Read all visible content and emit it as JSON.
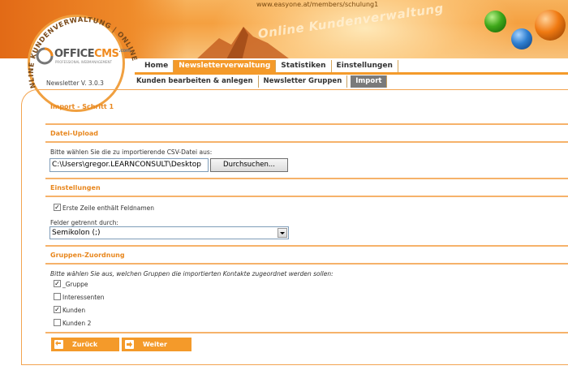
{
  "header": {
    "url": "www.easyone.at/members/schulung1",
    "tagline": "Online Kundenverwaltung",
    "ring_text": "NLINE KUNDENVERWALTUNG | ONLINE KUNDENVERWAL",
    "logo_main": "OFFICE",
    "logo_cms": "CMS",
    "logo_com": ".com",
    "logo_sub": "PROFESSIONAL WEBMANAGEMENT"
  },
  "nav": {
    "items": [
      {
        "label": "Home"
      },
      {
        "label": "Newsletterverwaltung"
      },
      {
        "label": "Statistiken"
      },
      {
        "label": "Einstellungen"
      }
    ],
    "active": "Newsletterverwaltung"
  },
  "version": "Newsletter V. 3.0.3",
  "subnav": {
    "items": [
      {
        "label": "Kunden bearbeiten & anlegen"
      },
      {
        "label": "Newsletter Gruppen"
      },
      {
        "label": "Import"
      }
    ],
    "active": "Import"
  },
  "page": {
    "title": "Import - Schritt 1",
    "upload": {
      "section_title": "Datei-Upload",
      "prompt": "Bitte wählen Sie die zu importierende CSV-Datei aus:",
      "file_value": "C:\\Users\\gregor.LEARNCONSULT\\Desktop",
      "browse_label": "Durchsuchen..."
    },
    "settings": {
      "section_title": "Einstellungen",
      "header_checkbox_label": "Erste Zeile enthält Feldnamen",
      "header_checkbox_checked": true,
      "separator_label": "Felder getrennt durch:",
      "separator_value": "Semikolon (;)"
    },
    "groups": {
      "section_title": "Gruppen-Zuordnung",
      "prompt": "Bitte wählen Sie aus, welchen Gruppen die importierten Kontakte zugeordnet werden sollen:",
      "items": [
        {
          "label": "_Gruppe",
          "checked": true
        },
        {
          "label": "Interessenten",
          "checked": false
        },
        {
          "label": "Kunden",
          "checked": true
        },
        {
          "label": "Kunden 2",
          "checked": false
        }
      ]
    },
    "buttons": {
      "back_label": "Zurück",
      "next_label": "Weiter"
    }
  },
  "colors": {
    "accent": "#f49a2a",
    "section_title": "#e8871e",
    "subnav_active": "#7a7a7a"
  }
}
